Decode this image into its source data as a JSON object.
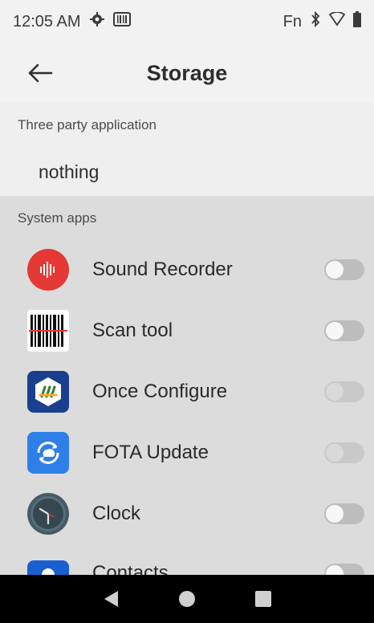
{
  "status": {
    "time": "12:05 AM",
    "fn_label": "Fn"
  },
  "header": {
    "title": "Storage"
  },
  "sections": {
    "third_party": {
      "label": "Three party application",
      "empty_text": "nothing"
    },
    "system": {
      "label": "System apps"
    }
  },
  "apps": [
    {
      "name": "Sound Recorder",
      "toggle_state": "off"
    },
    {
      "name": "Scan tool",
      "toggle_state": "off"
    },
    {
      "name": "Once Configure",
      "toggle_state": "disabled"
    },
    {
      "name": "FOTA Update",
      "toggle_state": "disabled"
    },
    {
      "name": "Clock",
      "toggle_state": "off"
    },
    {
      "name": "Contacts",
      "toggle_state": "off"
    }
  ],
  "colors": {
    "accent_blue": "#1a5fd0",
    "recorder_red": "#e53935",
    "navbar": "#000000"
  }
}
